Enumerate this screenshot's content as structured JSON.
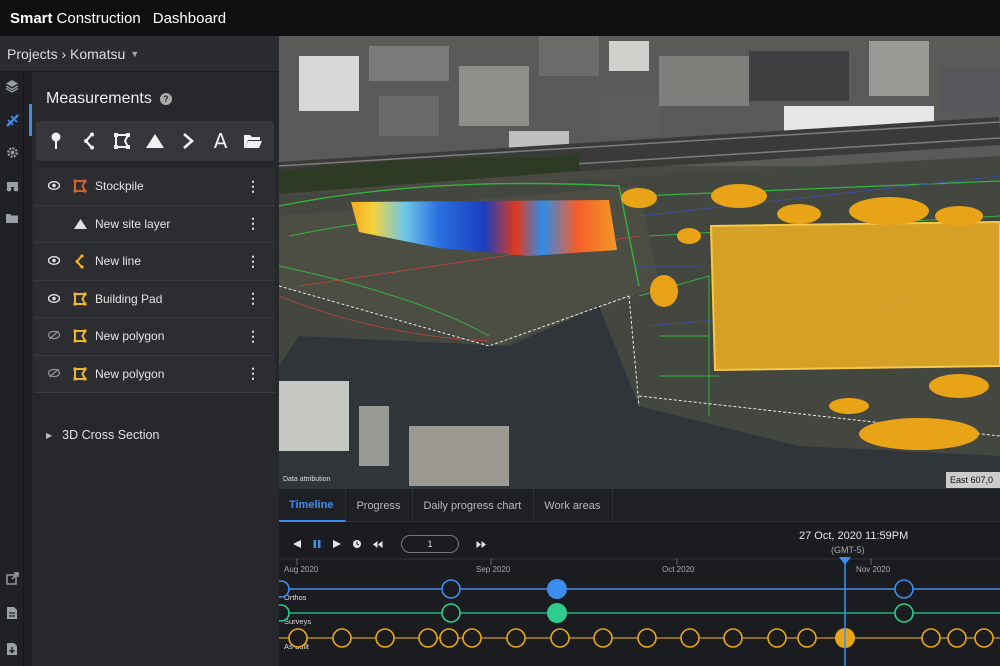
{
  "app": {
    "brand_bold": "Smart",
    "brand_normal": "Construction",
    "page": "Dashboard"
  },
  "breadcrumb": {
    "text": "Projects › Komatsu"
  },
  "rail": {
    "icons": [
      "layers-icon",
      "measure-tool-icon",
      "settings-icon",
      "equipment-icon",
      "folder-icon",
      "export-icon",
      "report-icon",
      "download-icon"
    ]
  },
  "panel": {
    "title": "Measurements",
    "tools": [
      "pin-icon",
      "polyline-icon",
      "polygon-icon",
      "volume-icon",
      "chevron-icon",
      "text-icon",
      "open-folder-icon"
    ],
    "layers": [
      {
        "name": "Stockpile",
        "visible": true,
        "icon": "polygon",
        "color": "#d4602a"
      },
      {
        "name": "New site layer",
        "visible": null,
        "icon": "triangle",
        "color": "#e0e0e0"
      },
      {
        "name": "New line",
        "visible": true,
        "icon": "line",
        "color": "#f0b429"
      },
      {
        "name": "Building Pad",
        "visible": true,
        "icon": "polygon",
        "color": "#f0b429"
      },
      {
        "name": "New polygon",
        "visible": false,
        "icon": "polygon",
        "color": "#f0b429"
      },
      {
        "name": "New polygon",
        "visible": false,
        "icon": "polygon",
        "color": "#f0b429"
      }
    ],
    "cross_section": "3D Cross Section"
  },
  "map": {
    "attribution": "Data attribution",
    "coordinate": "East 607,0"
  },
  "timeline": {
    "tabs": [
      "Timeline",
      "Progress",
      "Daily progress chart",
      "Work areas"
    ],
    "active_tab": "Timeline",
    "speed": "1",
    "current_date": "27 Oct, 2020 11:59PM",
    "timezone": "(GMT-5)",
    "months": [
      "Aug 2020",
      "Sep 2020",
      "Oct 2020",
      "Nov 2020"
    ],
    "rows": [
      "Orthos",
      "Surveys",
      "As-built"
    ],
    "colors": {
      "orthos": "#3d8df0",
      "surveys": "#2ecc8f",
      "asbuilt": "#e8a617"
    }
  }
}
